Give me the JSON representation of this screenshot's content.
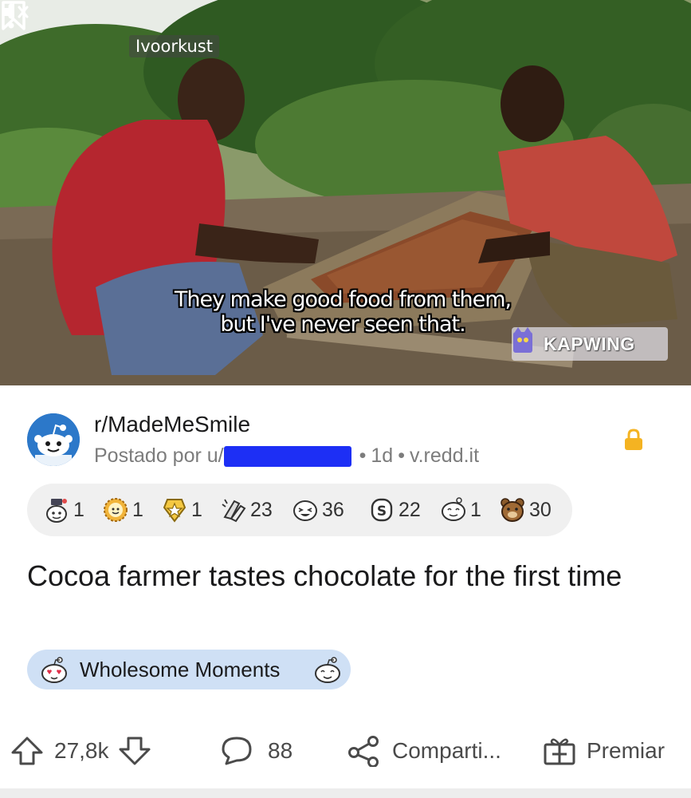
{
  "video": {
    "location_tag": "Ivoorkust",
    "subtitle_line1": "They make good food from them,",
    "subtitle_line2": "but I've never seen that.",
    "watermark": "KAPWING"
  },
  "post": {
    "subreddit": "r/MadeMeSmile",
    "posted_by_prefix": "Postado por u/",
    "age": "1d",
    "domain": "v.redd.it",
    "title": "Cocoa farmer tastes chocolate for the first time",
    "flair": "Wholesome Moments"
  },
  "awards": [
    {
      "icon": "wholesome-seal-icon",
      "count": "1"
    },
    {
      "icon": "sun-face-icon",
      "count": "1"
    },
    {
      "icon": "star-badge-icon",
      "count": "1"
    },
    {
      "icon": "hands-clap-icon",
      "count": "23"
    },
    {
      "icon": "laughing-face-icon",
      "count": "36"
    },
    {
      "icon": "coin-icon",
      "count": "22"
    },
    {
      "icon": "snoo-hug-icon",
      "count": "1"
    },
    {
      "icon": "bear-icon",
      "count": "30"
    }
  ],
  "actions": {
    "votes": "27,8k",
    "comments": "88",
    "share": "Comparti...",
    "award": "Premiar"
  },
  "colors": {
    "accent_lock": "#f4b322",
    "flair_bg": "#cfe0f5",
    "redaction": "#1d2ff5"
  }
}
